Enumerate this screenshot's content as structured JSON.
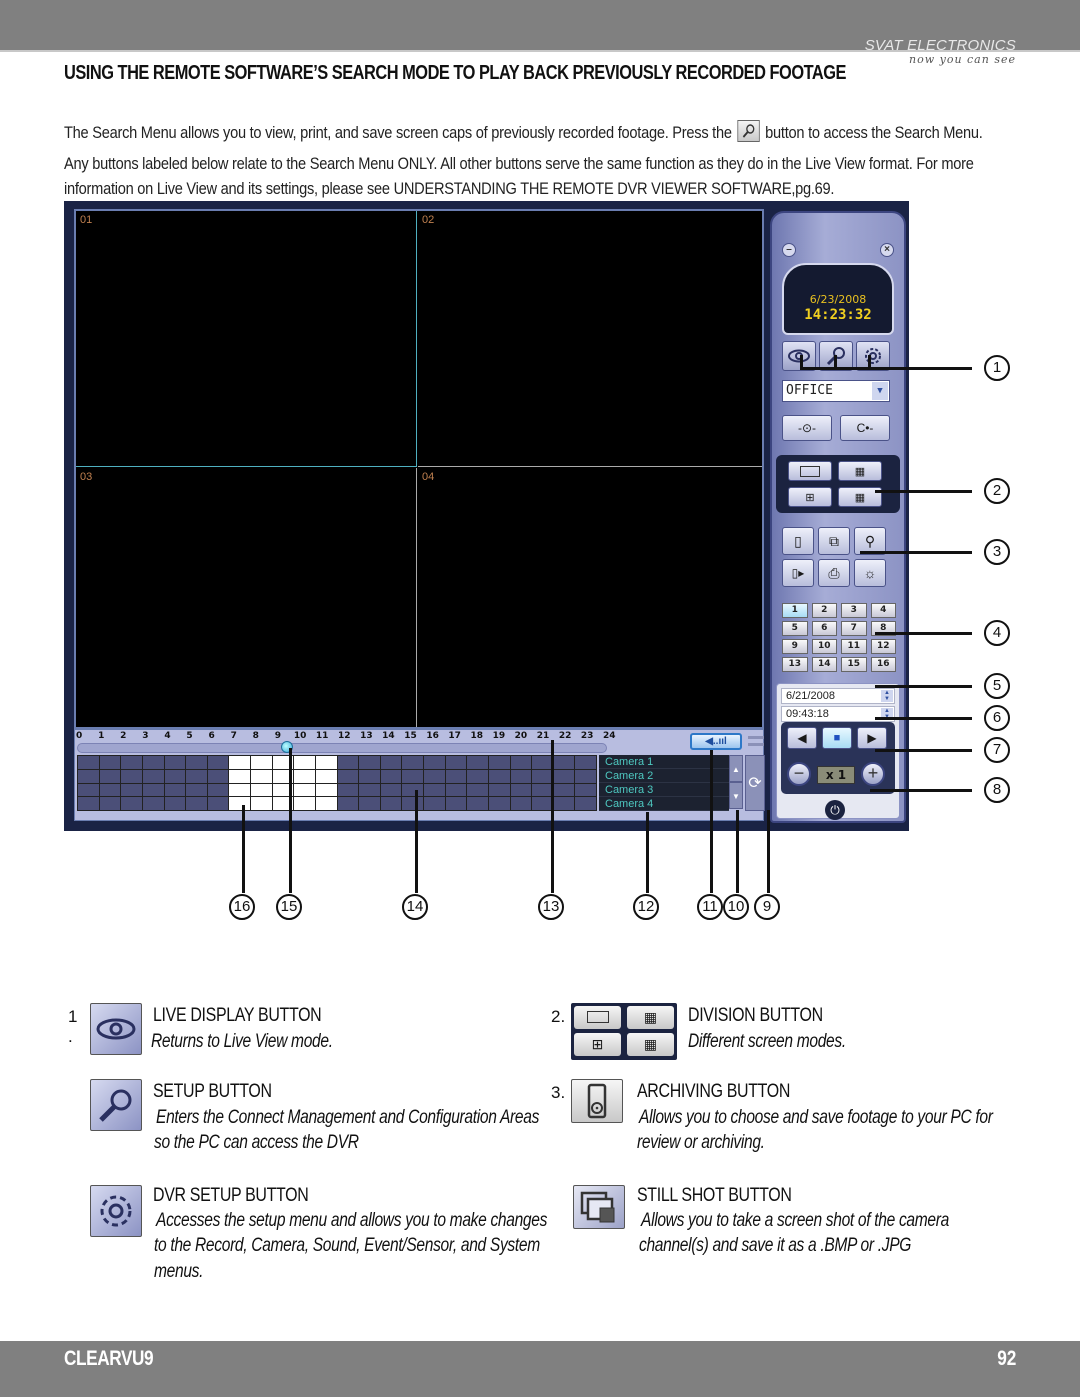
{
  "header": {
    "brand_name": "SVAT ELECTRONICS",
    "brand_tagline": "now you can see",
    "title": "USING THE REMOTE SOFTWARE’S SEARCH MODE TO PLAY BACK PREVIOUSLY RECORDED FOOTAGE"
  },
  "intro": {
    "line1_before": "The Search Menu allows you to view, print, and save screen caps of previously recorded footage.  Press the",
    "line1_icon": "search-icon",
    "line1_after": "button to access the Search Menu.",
    "line2": "Any  buttons labeled below relate to the Search Menu ONLY.  All other buttons serve the same function as they do in the Live View format.  For more",
    "line3": "information on Live View and its settings, please see UNDERSTANDING THE REMOTE DVR VIEWER SOFTWARE,pg.69."
  },
  "dvr": {
    "cameras": [
      "01",
      "02",
      "03",
      "04"
    ],
    "clock_date": "6/23/2008",
    "clock_time": "14:23:32",
    "site_select": "OFFICE",
    "hours": [
      "0",
      "1",
      "2",
      "3",
      "4",
      "5",
      "6",
      "7",
      "8",
      "9",
      "10",
      "11",
      "12",
      "13",
      "14",
      "15",
      "16",
      "17",
      "18",
      "19",
      "20",
      "21",
      "22",
      "23",
      "24"
    ],
    "slider_position_hour": 9.5,
    "recorded_hours": [
      7,
      8,
      9,
      10,
      11
    ],
    "camera_list": [
      "Camera 1",
      "Camera 2",
      "Camera 3",
      "Camera 4"
    ],
    "channel_buttons": [
      "1",
      "2",
      "3",
      "4",
      "5",
      "6",
      "7",
      "8",
      "9",
      "10",
      "11",
      "12",
      "13",
      "14",
      "15",
      "16"
    ],
    "active_channel": "1",
    "search_date": "6/21/2008",
    "search_time": "09:43:18",
    "speed": "x 1",
    "volume_label": "◀..ııl",
    "side_callouts": [
      "1",
      "2",
      "3",
      "4",
      "5",
      "6",
      "7",
      "8"
    ],
    "bottom_callouts": [
      "16",
      "15",
      "14",
      "13",
      "12",
      "11",
      "10",
      "9"
    ]
  },
  "legend": {
    "left": [
      {
        "num": "1 .",
        "icon": "eye-icon",
        "title": "LIVE DISPLAY BUTTON",
        "desc": [
          "Returns to Live View mode."
        ]
      },
      {
        "num": "",
        "icon": "wrench-icon",
        "title": "SETUP BUTTON",
        "desc": [
          "Enters the Connect Management and Configuration Areas",
          "so the PC can access the DVR"
        ]
      },
      {
        "num": "",
        "icon": "gear-icon",
        "title": "DVR SETUP BUTTON",
        "desc": [
          "Accesses the setup menu and allows you to make changes",
          "to the Record, Camera, Sound, Event/Sensor, and System",
          "menus."
        ]
      }
    ],
    "right": [
      {
        "num": "2.",
        "icon": "division-icon",
        "title": "DIVISION BUTTON",
        "desc": [
          "Different screen modes."
        ]
      },
      {
        "num": "3.",
        "icon": "archive-icon",
        "title": "ARCHIVING BUTTON",
        "desc": [
          "Allows you to choose and save footage to your PC for",
          "review or archiving."
        ]
      },
      {
        "num": "",
        "icon": "still-shot-icon",
        "title": "STILL SHOT BUTTON",
        "desc": [
          "Allows you to take a screen shot of the camera",
          "channel(s) and save it as a .BMP or .JPG"
        ]
      }
    ]
  },
  "footer": {
    "brand": "CLEARVU9",
    "page": "92"
  }
}
